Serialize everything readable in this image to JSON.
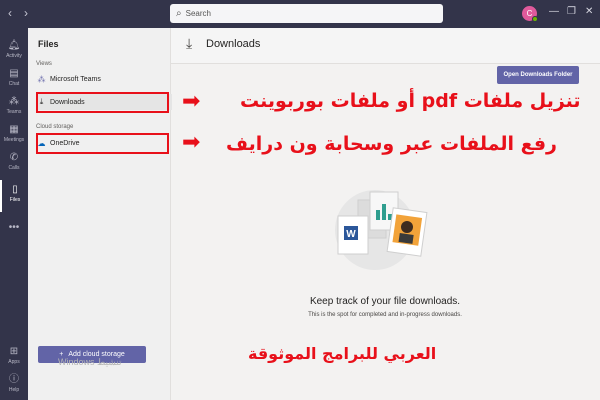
{
  "search": {
    "placeholder": "Search"
  },
  "avatar": {
    "initial": "C"
  },
  "rail": {
    "items": [
      {
        "label": "Activity",
        "icon": "bell-icon"
      },
      {
        "label": "Chat",
        "icon": "chat-icon"
      },
      {
        "label": "Teams",
        "icon": "teams-icon"
      },
      {
        "label": "Meetings",
        "icon": "calendar-icon"
      },
      {
        "label": "Calls",
        "icon": "phone-icon"
      },
      {
        "label": "Files",
        "icon": "file-icon"
      }
    ],
    "more": "•••",
    "bottom": [
      {
        "label": "Apps",
        "icon": "apps-icon"
      },
      {
        "label": "Help",
        "icon": "help-icon"
      }
    ]
  },
  "files_panel": {
    "title": "Files",
    "views_label": "Views",
    "views": [
      "Microsoft Teams",
      "Downloads"
    ],
    "cloud_label": "Cloud storage",
    "cloud": [
      "OneDrive"
    ],
    "add_button": "Add cloud storage"
  },
  "main": {
    "title": "Downloads",
    "open_button": "Open Downloads Folder",
    "empty_title": "Keep track of your file downloads.",
    "empty_subtitle": "This is the spot for completed and in-progress downloads."
  },
  "annotations": {
    "line1": "تنزيل ملفات pdf أو ملفات بوربوينت",
    "line2": "رفع الملفات عبر وسحابة ون درايف",
    "line3": "العربي للبرامج الموثوقة"
  },
  "watermark": "Windows تنشيط",
  "colors": {
    "accent": "#6264a7",
    "rail": "#33344a",
    "annotation_red": "#e8101a"
  }
}
